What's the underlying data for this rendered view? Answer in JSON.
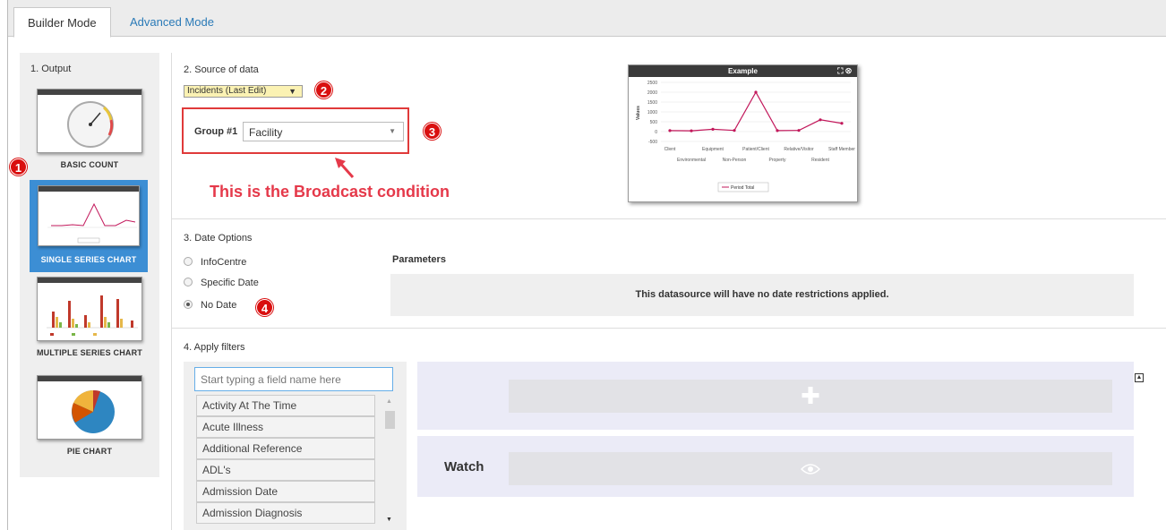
{
  "tabs": [
    {
      "label": "Builder Mode",
      "active": true
    },
    {
      "label": "Advanced Mode",
      "active": false
    }
  ],
  "output": {
    "title": "1. Output",
    "cards": [
      {
        "label": "BASIC COUNT",
        "thumb_title": "Example"
      },
      {
        "label": "SINGLE SERIES CHART",
        "thumb_title": "Example",
        "selected": true
      },
      {
        "label": "MULTIPLE SERIES CHART",
        "thumb_title": "Example"
      },
      {
        "label": "PIE CHART",
        "thumb_title": "Example"
      }
    ]
  },
  "badges": [
    "1",
    "2",
    "3",
    "4"
  ],
  "source": {
    "title": "2. Source of data",
    "selected": "Incidents (Last Edit)",
    "group_label": "Group #1",
    "group_value": "Facility",
    "annotation": "This is the Broadcast condition"
  },
  "preview": {
    "title": "Example",
    "ylabel": "Values",
    "yticks": [
      "2500",
      "2000",
      "1500",
      "1000",
      "500",
      "0",
      "-500"
    ],
    "xlabels_top": [
      "Client",
      "Equipment",
      "Patient/Client",
      "Relative/Visitor",
      "Staff Member"
    ],
    "xlabels_bottom": [
      "Environmental",
      "Non-Person",
      "Property",
      "Resident"
    ],
    "legend": "Period Total",
    "accent": "#c2185b"
  },
  "chart_data": {
    "type": "line",
    "title": "Example",
    "ylabel": "Values",
    "ylim": [
      -500,
      2500
    ],
    "categories": [
      "Client",
      "Environmental",
      "Equipment",
      "Non-Person",
      "Patient/Client",
      "Property",
      "Relative/Visitor",
      "Resident",
      "Staff Member"
    ],
    "series": [
      {
        "name": "Period Total",
        "values": [
          50,
          40,
          120,
          60,
          2000,
          50,
          60,
          600,
          420
        ]
      }
    ]
  },
  "dates": {
    "title": "3. Date Options",
    "options": [
      {
        "label": "InfoCentre",
        "checked": false
      },
      {
        "label": "Specific Date",
        "checked": false
      },
      {
        "label": "No Date",
        "checked": true
      }
    ],
    "params_label": "Parameters",
    "params_message": "This datasource will have no date restrictions applied."
  },
  "filters": {
    "title": "4. Apply filters",
    "placeholder": "Start typing a field name here",
    "fields": [
      "Activity At The Time",
      "Acute Illness",
      "Additional Reference",
      "ADL's",
      "Admission Date",
      "Admission Diagnosis"
    ],
    "add_icon": "plus-icon",
    "watch_label": "Watch",
    "watch_icon": "eye-icon"
  }
}
